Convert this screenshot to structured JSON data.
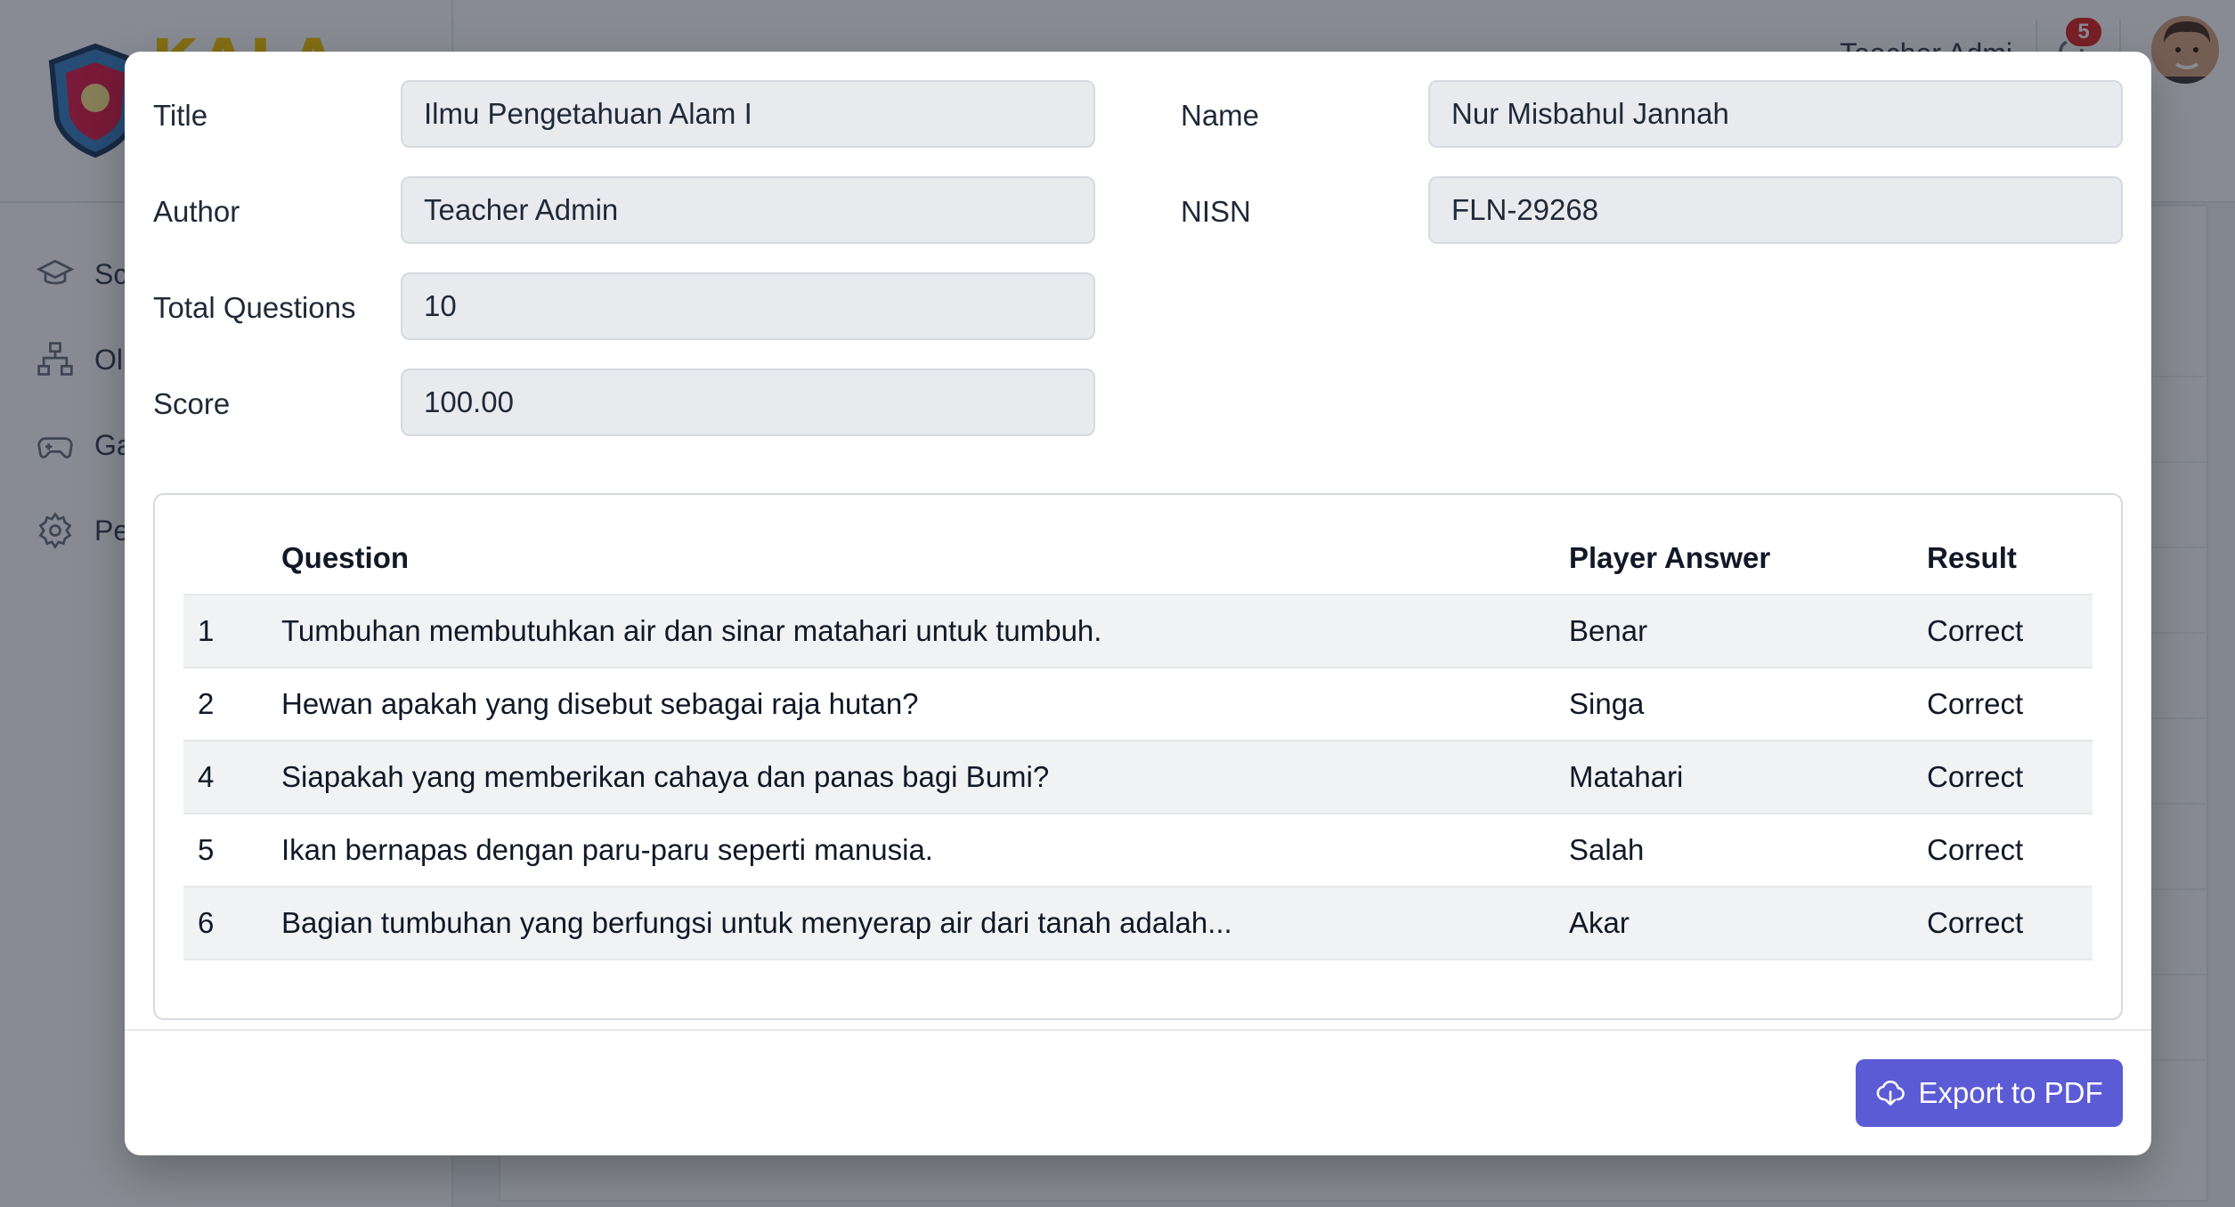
{
  "background": {
    "sidebar_items": [
      {
        "label": "Sc",
        "icon": "graduation-cap-icon"
      },
      {
        "label": "Ol",
        "icon": "sitemap-icon"
      },
      {
        "label": "Ga",
        "icon": "gamepad-icon"
      },
      {
        "label": "Pe",
        "icon": "gear-icon"
      }
    ],
    "topbar_user": "Teacher Admi",
    "notification_count": "5"
  },
  "modal": {
    "fields": {
      "title": {
        "label": "Title",
        "value": "Ilmu Pengetahuan Alam I"
      },
      "author": {
        "label": "Author",
        "value": "Teacher Admin"
      },
      "total_questions": {
        "label": "Total Questions",
        "value": "10"
      },
      "score": {
        "label": "Score",
        "value": "100.00"
      },
      "name": {
        "label": "Name",
        "value": "Nur Misbahul Jannah"
      },
      "nisn": {
        "label": "NISN",
        "value": "FLN-29268"
      }
    },
    "table": {
      "headers": {
        "number": "",
        "question": "Question",
        "answer": "Player Answer",
        "result": "Result"
      },
      "rows": [
        {
          "no": "1",
          "question": "Tumbuhan membutuhkan air dan sinar matahari untuk tumbuh.",
          "answer": "Benar",
          "result": "Correct"
        },
        {
          "no": "2",
          "question": "Hewan apakah yang disebut sebagai raja hutan?",
          "answer": "Singa",
          "result": "Correct"
        },
        {
          "no": "4",
          "question": "Siapakah yang memberikan cahaya dan panas bagi Bumi?",
          "answer": "Matahari",
          "result": "Correct"
        },
        {
          "no": "5",
          "question": "Ikan bernapas dengan paru-paru seperti manusia.",
          "answer": "Salah",
          "result": "Correct"
        },
        {
          "no": "6",
          "question": "Bagian tumbuhan yang berfungsi untuk menyerap air dari tanah adalah...",
          "answer": "Akar",
          "result": "Correct"
        }
      ]
    },
    "export_label": "Export to PDF",
    "export_icon": "cloud-download-icon",
    "colors": {
      "accent": "#5b5bd6",
      "badge": "#dc2626"
    }
  }
}
